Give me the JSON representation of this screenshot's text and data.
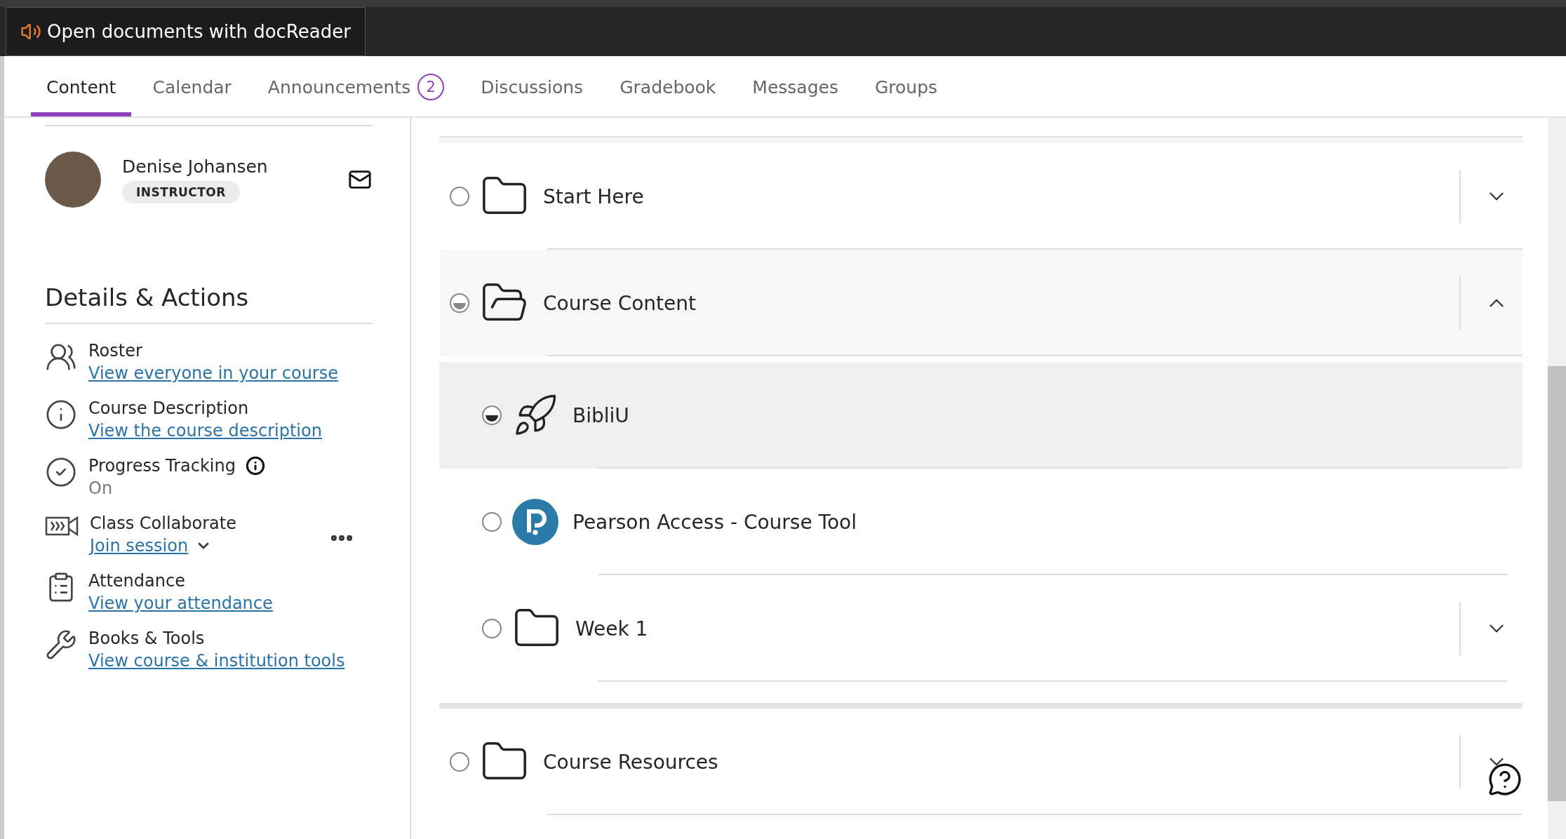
{
  "toolbar": {
    "docreader_button": "Open documents with docReader"
  },
  "tabs": [
    {
      "label": "Content",
      "selected": true
    },
    {
      "label": "Calendar",
      "selected": false
    },
    {
      "label": "Announcements",
      "badge": "2",
      "selected": false
    },
    {
      "label": "Discussions",
      "selected": false
    },
    {
      "label": "Gradebook",
      "selected": false
    },
    {
      "label": "Messages",
      "selected": false
    },
    {
      "label": "Groups",
      "selected": false
    }
  ],
  "instructor": {
    "name": "Denise Johansen",
    "role": "INSTRUCTOR"
  },
  "details": {
    "title": "Details & Actions",
    "items": [
      {
        "kind": "roster",
        "title": "Roster",
        "link": "View everyone in your course"
      },
      {
        "kind": "description",
        "title": "Course Description",
        "link": "View the course description"
      },
      {
        "kind": "progress",
        "title": "Progress Tracking",
        "status": "On"
      },
      {
        "kind": "collaborate",
        "title": "Class Collaborate",
        "link": "Join session",
        "dropdown": true,
        "more_menu": true
      },
      {
        "kind": "attendance",
        "title": "Attendance",
        "link": "View your attendance"
      },
      {
        "kind": "tools",
        "title": "Books & Tools",
        "link": "View course & institution tools"
      }
    ]
  },
  "content": [
    {
      "kind": "folder",
      "title": "Start Here",
      "started": false,
      "expanded": false,
      "selected": false
    },
    {
      "kind": "folder",
      "title": "Course Content",
      "started": true,
      "expanded": true,
      "selected": false,
      "children": [
        {
          "kind": "rocket",
          "title": "BibliU",
          "started": true,
          "selected": true
        },
        {
          "kind": "logo",
          "title": "Pearson Access - Course Tool",
          "started": false,
          "selected": false
        },
        {
          "kind": "folder",
          "title": "Week 1",
          "started": false,
          "expanded": false,
          "selected": false
        }
      ]
    },
    {
      "kind": "folder",
      "title": "Course Resources",
      "started": false,
      "expanded": false,
      "selected": false
    }
  ]
}
